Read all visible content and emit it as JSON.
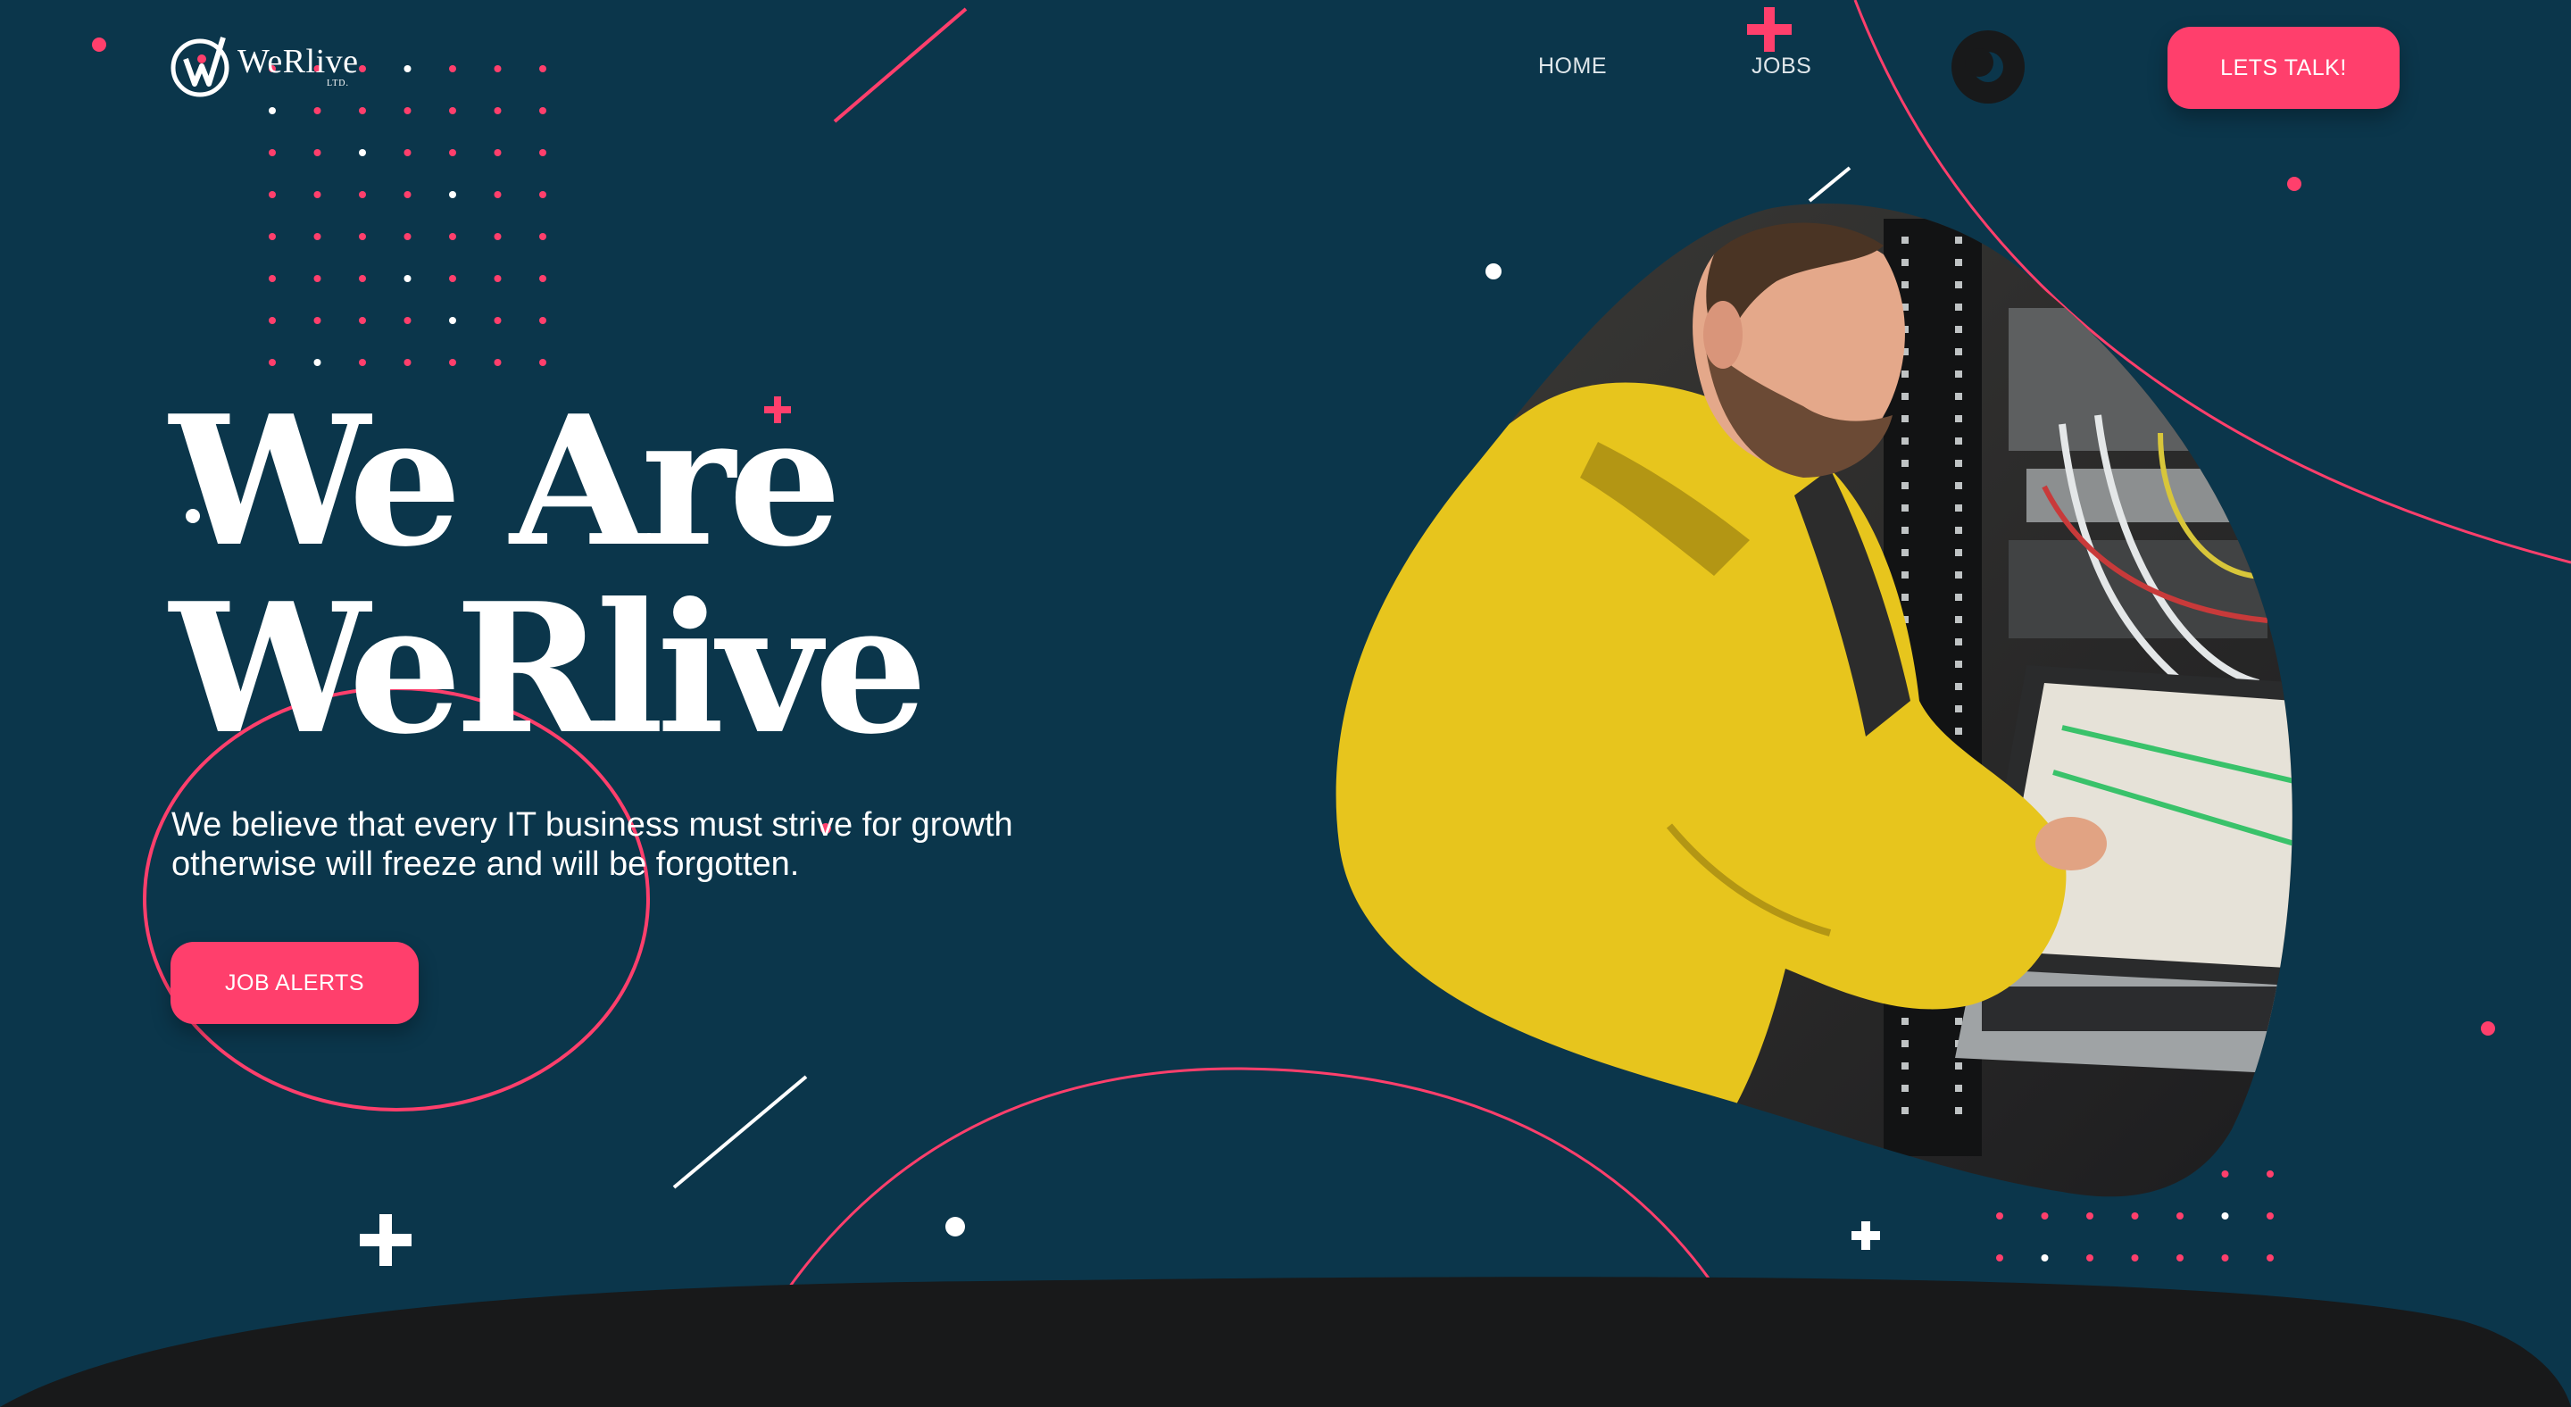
{
  "brand": {
    "name": "WeRlive",
    "suffix": "LTD."
  },
  "nav": {
    "home": "HOME",
    "jobs": "JOBS"
  },
  "header": {
    "cta_label": "LETS TALK!"
  },
  "hero": {
    "title_line1": "We Are",
    "title_line2": "WeRlive",
    "description": "We believe that every IT business must strive for growth otherwise will freeze and will be forgotten.",
    "cta_label": "JOB ALERTS"
  },
  "colors": {
    "background": "#0b364b",
    "accent": "#ff3f6c",
    "dark": "#18191a",
    "text": "#ffffff"
  },
  "icons": {
    "logo": "w-checkmark-logo-icon",
    "theme_toggle": "moon-icon",
    "decor": [
      "plus-icon",
      "dot-grid-icon",
      "ring-outline-icon",
      "slash-line-icon"
    ]
  }
}
